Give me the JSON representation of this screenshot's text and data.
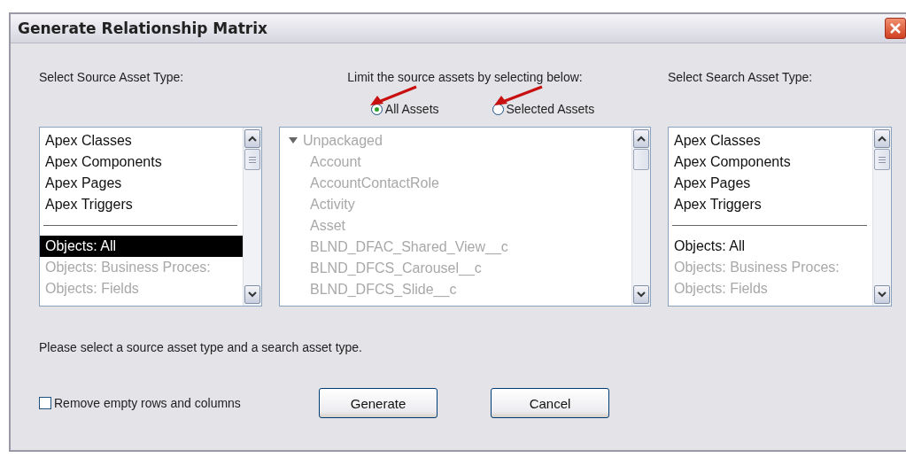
{
  "window": {
    "title": "Generate Relationship Matrix"
  },
  "source": {
    "label": "Select Source Asset Type:",
    "items": [
      {
        "kind": "item",
        "label": "Apex Classes",
        "selected": false,
        "disabled": false
      },
      {
        "kind": "item",
        "label": "Apex Components",
        "selected": false,
        "disabled": false
      },
      {
        "kind": "item",
        "label": "Apex Pages",
        "selected": false,
        "disabled": false
      },
      {
        "kind": "item",
        "label": "Apex Triggers",
        "selected": false,
        "disabled": false
      },
      {
        "kind": "separator"
      },
      {
        "kind": "item",
        "label": "Objects: All",
        "selected": true,
        "disabled": false
      },
      {
        "kind": "item",
        "label": "Objects: Business Proces:",
        "selected": false,
        "disabled": true
      },
      {
        "kind": "item",
        "label": "Objects: Fields",
        "selected": false,
        "disabled": true
      }
    ]
  },
  "limit": {
    "label": "Limit the source assets by selecting below:",
    "options": [
      {
        "label": "All Assets",
        "selected": true
      },
      {
        "label": "Selected Assets",
        "selected": false
      }
    ],
    "tree": {
      "disabled": true,
      "nodes": [
        {
          "label": "Unpackaged",
          "expanded": true,
          "children": [
            {
              "label": "Account"
            },
            {
              "label": "AccountContactRole"
            },
            {
              "label": "Activity"
            },
            {
              "label": "Asset"
            },
            {
              "label": "BLND_DFAC_Shared_View__c"
            },
            {
              "label": "BLND_DFCS_Carousel__c"
            },
            {
              "label": "BLND_DFCS_Slide__c"
            }
          ]
        }
      ]
    }
  },
  "search": {
    "label": "Select Search Asset Type:",
    "items": [
      {
        "kind": "item",
        "label": "Apex Classes",
        "selected": false,
        "disabled": false
      },
      {
        "kind": "item",
        "label": "Apex Components",
        "selected": false,
        "disabled": false
      },
      {
        "kind": "item",
        "label": "Apex Pages",
        "selected": false,
        "disabled": false
      },
      {
        "kind": "item",
        "label": "Apex Triggers",
        "selected": false,
        "disabled": false
      },
      {
        "kind": "separator"
      },
      {
        "kind": "item",
        "label": "Objects: All",
        "selected": false,
        "disabled": false
      },
      {
        "kind": "item",
        "label": "Objects: Business Proces:",
        "selected": false,
        "disabled": true
      },
      {
        "kind": "item",
        "label": "Objects: Fields",
        "selected": false,
        "disabled": true
      }
    ]
  },
  "message": "Please select a source asset type and a search asset type.",
  "remove_empty": {
    "label": "Remove empty rows and columns",
    "checked": false
  },
  "buttons": [
    "Generate",
    "Cancel"
  ]
}
